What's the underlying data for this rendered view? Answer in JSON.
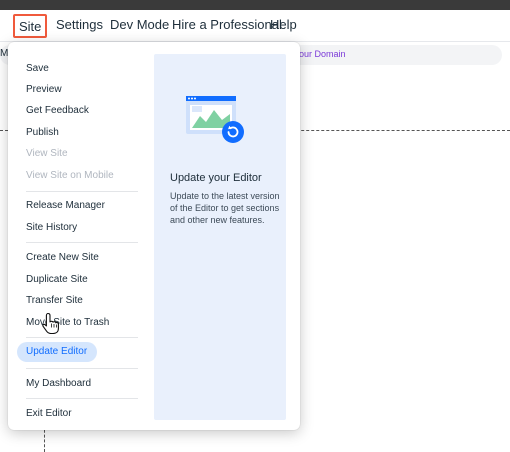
{
  "menubar": {
    "items": [
      "Site",
      "Settings",
      "Dev Mode",
      "Hire a Professional",
      "Help"
    ],
    "active": "Site"
  },
  "urlbar": {
    "left_text": "MI",
    "link_text": "t Your Domain"
  },
  "dropdown": {
    "groups": [
      [
        "Save",
        "Preview",
        "Get Feedback",
        "Publish",
        "View Site",
        "View Site on Mobile"
      ],
      [
        "Release Manager",
        "Site History"
      ],
      [
        "Create New Site",
        "Duplicate Site",
        "Transfer Site",
        "Move Site to Trash"
      ],
      [
        "Update Editor"
      ],
      [
        "My Dashboard"
      ],
      [
        "Exit Editor"
      ]
    ],
    "disabled": [
      "View Site",
      "View Site on Mobile"
    ],
    "highlighted": "Update Editor"
  },
  "panel": {
    "title": "Update your Editor",
    "text": "Update to the latest version of the Editor to get sections and other new features."
  },
  "icons": {
    "illustration": "browser-update-illustration",
    "cursor": "hand-pointer-cursor"
  },
  "colors": {
    "accent": "#116dff",
    "active_outline": "#f05a3c",
    "highlight_bg": "#d5e6fd",
    "panel_bg": "#e9f0fc",
    "link_purple": "#7b3ad8"
  }
}
